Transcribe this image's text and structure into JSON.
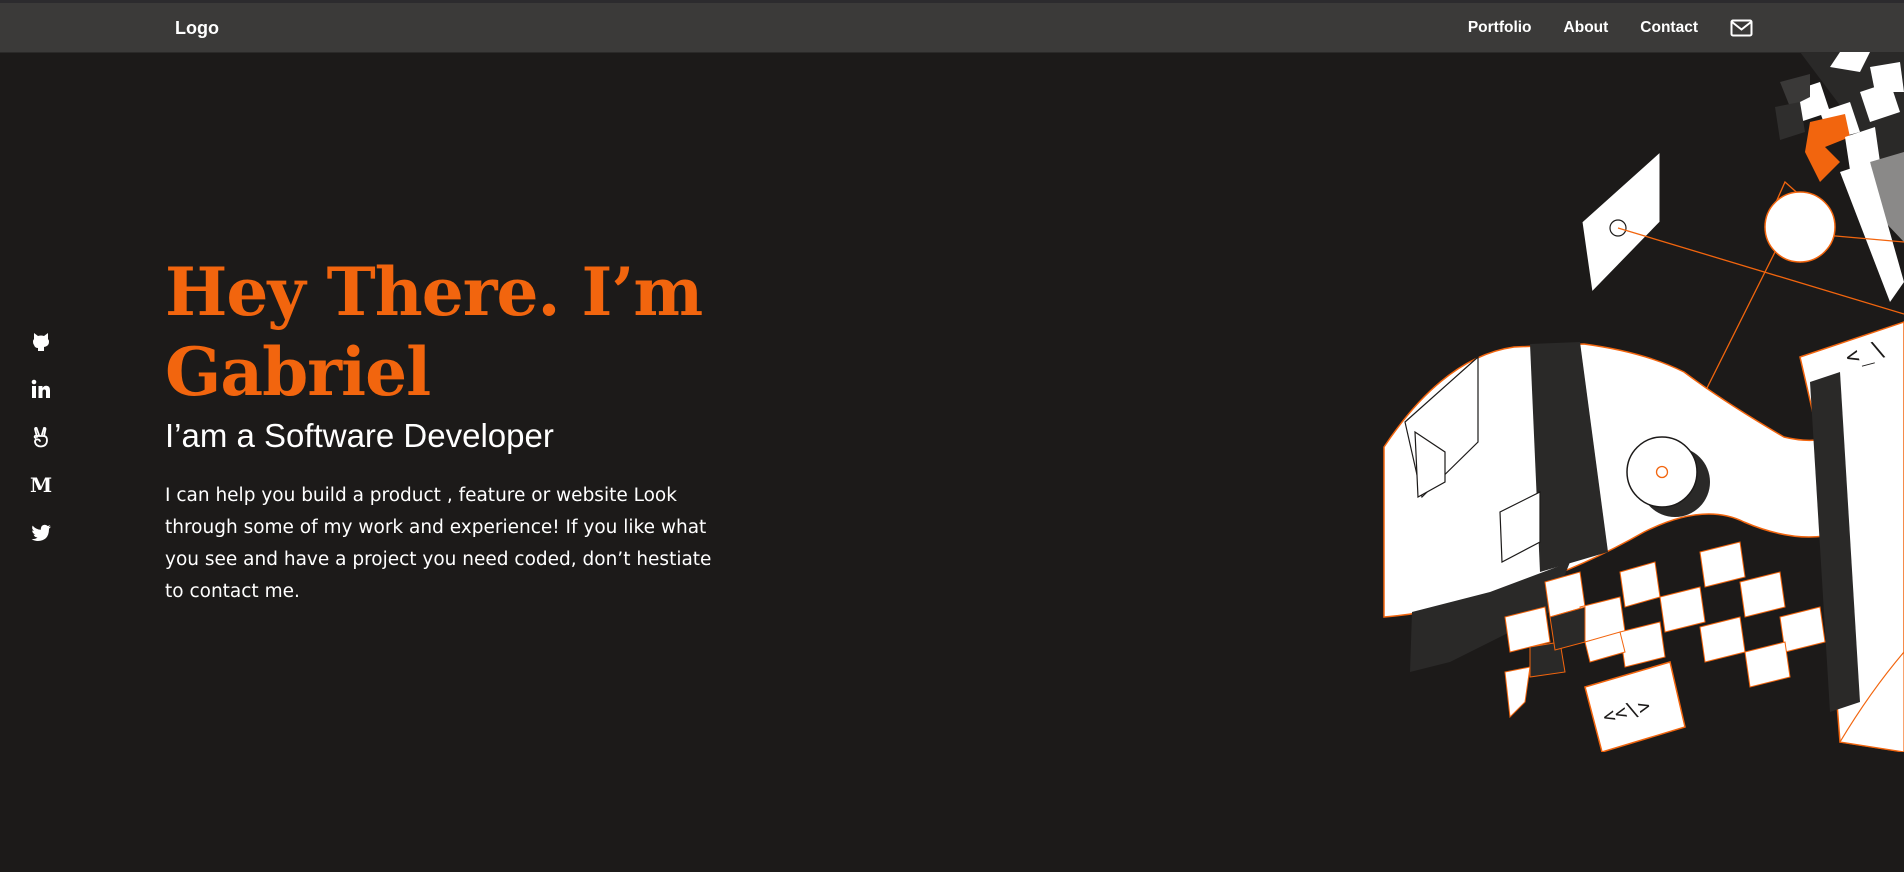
{
  "nav": {
    "logo": "Logo",
    "links": [
      "Portfolio",
      "About",
      "Contact"
    ],
    "mail_icon": "mail-icon"
  },
  "social": {
    "icons": [
      "github-icon",
      "linkedin-icon",
      "angellist-icon",
      "medium-icon",
      "twitter-icon"
    ],
    "medium_glyph": "M"
  },
  "hero": {
    "title_line1": "Hey There. I’m",
    "title_line2": "Gabriel",
    "subtitle": "I’am a Software Developer",
    "description": "I can help you build a product , feature or website Look through some of my work and experience! If you like what you see and have a project you need coded, don’t hestiate to contact me."
  },
  "illustration": {
    "code_tag_1": "<_\\",
    "code_tag_2": "<<\\>"
  },
  "colors": {
    "background": "#1c1a19",
    "navbar": "#3b3a39",
    "accent": "#f2650e",
    "text": "#ffffff"
  }
}
